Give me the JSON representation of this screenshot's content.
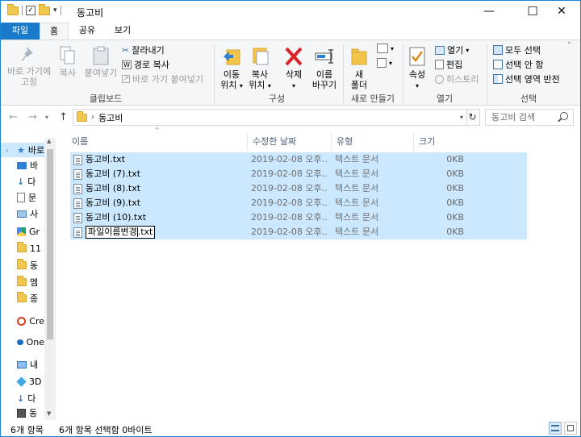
{
  "window": {
    "title": "동고비",
    "controls": {
      "minimize": "—",
      "maximize": "☐",
      "close": "✕"
    }
  },
  "ribbon_tabs": [
    {
      "label": "파일"
    },
    {
      "label": "홈"
    },
    {
      "label": "공유"
    },
    {
      "label": "보기"
    }
  ],
  "ribbon": {
    "clipboard": {
      "pin_label_1": "바로 가기에",
      "pin_label_2": "고정",
      "copy_label": "복사",
      "paste_label": "붙여넣기",
      "cut_label": "잘라내기",
      "copy_path_label": "경로 복사",
      "paste_shortcut_label": "바로 가기 붙여넣기",
      "group_label": "클립보드"
    },
    "organize": {
      "move_label_1": "이동",
      "move_label_2": "위치",
      "copyto_label_1": "복사",
      "copyto_label_2": "위치",
      "delete_label": "삭제",
      "rename_label_1": "이름",
      "rename_label_2": "바꾸기",
      "group_label": "구성"
    },
    "new": {
      "newfolder_label_1": "새",
      "newfolder_label_2": "폴더",
      "group_label": "새로 만들기"
    },
    "open": {
      "properties_label": "속성",
      "open_label": "열기",
      "edit_label": "편집",
      "history_label": "히스토리",
      "group_label": "열기"
    },
    "select": {
      "select_all_label": "모두 선택",
      "select_none_label": "선택 안 함",
      "invert_label": "선택 영역 반전",
      "group_label": "선택"
    }
  },
  "address": {
    "path_item": "동고비",
    "search_placeholder": "동고비 검색"
  },
  "nav_pane": {
    "items": [
      {
        "label": "바로"
      },
      {
        "label": "바"
      },
      {
        "label": "다"
      },
      {
        "label": "문"
      },
      {
        "label": "사"
      },
      {
        "label": "Gr"
      },
      {
        "label": "11"
      },
      {
        "label": "동"
      },
      {
        "label": "엠"
      },
      {
        "label": "종"
      },
      {
        "label": "Cre"
      },
      {
        "label": "One"
      },
      {
        "label": "내"
      },
      {
        "label": "3D"
      },
      {
        "label": "다"
      },
      {
        "label": "동"
      }
    ]
  },
  "list": {
    "columns": {
      "name": "이름",
      "date": "수정한 날짜",
      "type": "유형",
      "size": "크기"
    },
    "rows": [
      {
        "name": "동고비.txt",
        "date": "2019-02-08 오후...",
        "type": "텍스트 문서",
        "size": "0KB"
      },
      {
        "name": "동고비 (7).txt",
        "date": "2019-02-08 오후...",
        "type": "텍스트 문서",
        "size": "0KB"
      },
      {
        "name": "동고비 (8).txt",
        "date": "2019-02-08 오후...",
        "type": "텍스트 문서",
        "size": "0KB"
      },
      {
        "name": "동고비 (9).txt",
        "date": "2019-02-08 오후...",
        "type": "텍스트 문서",
        "size": "0KB"
      },
      {
        "name": "동고비 (10).txt",
        "date": "2019-02-08 오후...",
        "type": "텍스트 문서",
        "size": "0KB"
      }
    ],
    "rename_row": {
      "name_selected": "파일이름변경",
      "name_ext": ".txt",
      "date": "2019-02-08 오후...",
      "type": "텍스트 문서",
      "size": "0KB"
    }
  },
  "status": {
    "count": "6개 항목",
    "selection": "6개 항목 선택함 0바이트"
  }
}
